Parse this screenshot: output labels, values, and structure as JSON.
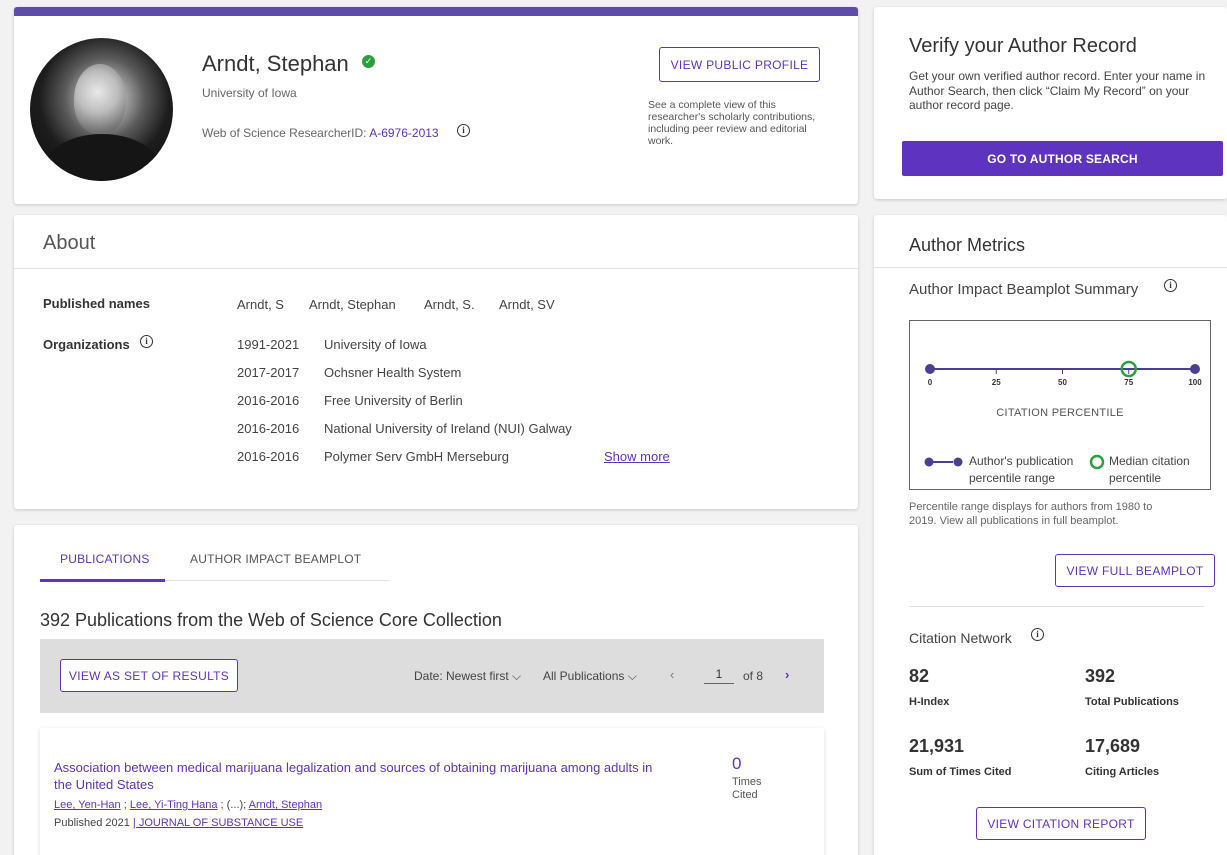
{
  "profile": {
    "name": "Arndt, Stephan",
    "verified_mark": "✓",
    "university": "University of Iowa",
    "researcher_id_label": "Web of Science ResearcherID: ",
    "researcher_id": "A-6976-2013",
    "info_glyph": "i",
    "view_public_label": "VIEW PUBLIC PROFILE",
    "public_desc": "See a complete view of this researcher's scholarly contributions, including peer review and editorial work."
  },
  "verify": {
    "title": "Verify your Author Record",
    "description": "Get your own verified author record. Enter your name in Author Search, then click “Claim My Record” on your author record page.",
    "button_label": "GO TO AUTHOR SEARCH"
  },
  "about": {
    "title": "About",
    "published_names_label": "Published names",
    "published_names": [
      "Arndt, S",
      "Arndt, Stephan",
      "Arndt, S.",
      "Arndt, SV"
    ],
    "organizations_label": "Organizations",
    "organizations": [
      {
        "years": "1991-2021",
        "name": "University of Iowa"
      },
      {
        "years": "2017-2017",
        "name": "Ochsner Health System"
      },
      {
        "years": "2016-2016",
        "name": "Free University of Berlin"
      },
      {
        "years": "2016-2016",
        "name": "National University of Ireland (NUI) Galway"
      },
      {
        "years": "2016-2016",
        "name": "Polymer Serv GmbH Merseburg"
      }
    ],
    "show_more": "Show more"
  },
  "publications": {
    "tabs": [
      "PUBLICATIONS",
      "AUTHOR IMPACT BEAMPLOT"
    ],
    "heading": "392 Publications from the Web of Science Core Collection",
    "view_set_label": "VIEW AS SET OF RESULTS",
    "sort_label": "Date: Newest first",
    "filter_label": "All Publications",
    "dropdown_glyph": "⌵",
    "prev_glyph": "‹",
    "next_glyph": "›",
    "page_current": "1",
    "page_total_label": "of 8",
    "first_item": {
      "title": "Association between medical marijuana legalization and sources of obtaining marijuana among adults in the United States",
      "author1": "Lee, Yen-Han",
      "author2": "Lee, Yi-Ting Hana",
      "ellipsis": " ; (...); ",
      "author3": "Arndt, Stephan",
      "sep": " ; ",
      "published": "Published 2021 ",
      "journal": "| JOURNAL OF SUBSTANCE USE",
      "times_cited": "0",
      "times_cited_label": "Times Cited"
    }
  },
  "metrics": {
    "title": "Author Metrics",
    "beamplot_title": "Author Impact Beamplot Summary",
    "beamplot_ticks": [
      "0",
      "25",
      "50",
      "75",
      "100"
    ],
    "beamplot_range": [
      0,
      100
    ],
    "median_percentile": 75,
    "beamplot_caption": "CITATION PERCENTILE",
    "legend_range": "Author's publication percentile range",
    "legend_median": "Median citation percentile",
    "note": "Percentile range displays for authors from 1980 to 2019. View all publications in full beamplot.",
    "view_beamplot_label": "VIEW FULL BEAMPLOT",
    "citation_network_title": "Citation Network",
    "h_index": "82",
    "h_index_label": "H-Index",
    "total_pubs": "392",
    "total_pubs_label": "Total Publications",
    "times_cited": "21,931",
    "times_cited_label": "Sum of Times Cited",
    "citing_articles": "17,689",
    "citing_articles_label": "Citing Articles",
    "view_citation_label": "VIEW CITATION REPORT"
  },
  "colors": {
    "accent": "#5e33bf",
    "header_bar": "#5e4caa",
    "verified": "#2e9f3e",
    "median_marker": "#2e9f3e"
  }
}
